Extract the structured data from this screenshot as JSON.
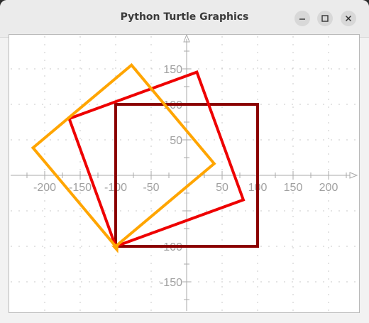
{
  "window": {
    "title": "Python Turtle Graphics",
    "controls": [
      "minimize",
      "maximize",
      "close"
    ]
  },
  "canvas": {
    "background": "#ffffff",
    "axis_color": "#aaaaaa",
    "grid_style": "dotted",
    "x_tick_labels": [
      "-200",
      "-150",
      "-100",
      "-50",
      "50",
      "100",
      "150",
      "200"
    ],
    "y_tick_labels": [
      "150",
      "100",
      "50",
      "-100",
      "-150"
    ],
    "shapes": [
      {
        "name": "dark-red-square",
        "color": "#8b0000",
        "points": [
          [
            -100,
            -100
          ],
          [
            100,
            -100
          ],
          [
            100,
            100
          ],
          [
            -100,
            100
          ]
        ]
      },
      {
        "name": "red-square",
        "color": "#ee0000",
        "points": [
          [
            -100,
            -100
          ],
          [
            79.9,
            -34.5
          ],
          [
            14.4,
            145.4
          ],
          [
            -165.5,
            79.9
          ]
        ]
      },
      {
        "name": "orange-square",
        "color": "#ffa500",
        "points": [
          [
            -100,
            -100
          ],
          [
            38.8,
            16.5
          ],
          [
            -77.7,
            155.3
          ],
          [
            -216.5,
            38.8
          ]
        ]
      }
    ],
    "turtle": {
      "color": "#ffa500",
      "position": [
        -100,
        -100
      ],
      "heading": -70
    }
  }
}
